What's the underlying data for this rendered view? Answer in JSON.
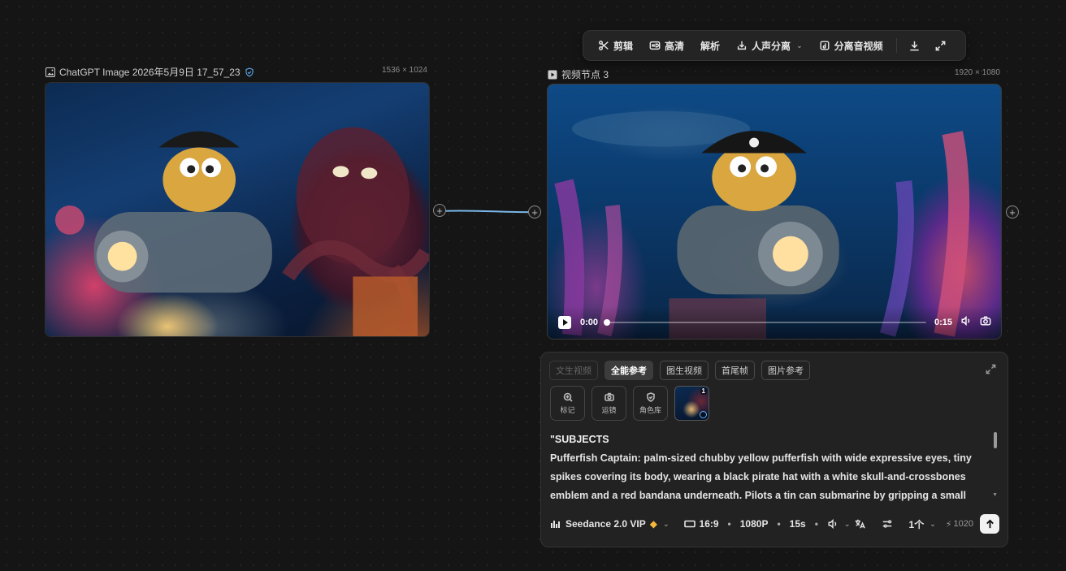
{
  "toolbar": {
    "cut_label": "剪辑",
    "hd_label": "高清",
    "parse_label": "解析",
    "vocal_label": "人声分离",
    "av_split_label": "分离音视频",
    "icons": [
      "scissors-icon",
      "hd-icon",
      "vocal-split-icon",
      "av-split-icon",
      "download-icon",
      "fullscreen-icon"
    ]
  },
  "image_node": {
    "title": "ChatGPT Image 2026年5月9日 17_57_23",
    "dimensions": "1536 × 1024"
  },
  "video_node": {
    "title": "视频节点 3",
    "dimensions": "1920 × 1080",
    "current_time": "0:00",
    "duration": "0:15",
    "progress": 0
  },
  "panel": {
    "tabs": [
      {
        "label": "文生视频",
        "state": "disabled"
      },
      {
        "label": "全能参考",
        "state": "active"
      },
      {
        "label": "图生视频",
        "state": "normal"
      },
      {
        "label": "首尾帧",
        "state": "normal"
      },
      {
        "label": "图片参考",
        "state": "normal"
      }
    ],
    "tools": [
      {
        "label": "标记",
        "icon": "marker-icon"
      },
      {
        "label": "运镜",
        "icon": "camera-icon"
      },
      {
        "label": "角色库",
        "icon": "shield-icon"
      }
    ],
    "reference_badge": "1",
    "prompt_title": "\"SUBJECTS",
    "prompt_text": "Pufferfish Captain: palm-sized chubby yellow pufferfish with wide expressive eyes, tiny spikes covering its body, wearing a black pirate hat with a white skull-and-crossbones emblem and a red bandana underneath. Pilots a tin can submarine by gripping a small brass",
    "model": "Seedance 2.0 VIP",
    "ratio": "16:9",
    "resolution": "1080P",
    "duration": "15s",
    "count": "1个",
    "credits": "1020"
  },
  "colors": {
    "background": "#151515",
    "panel": "#222222",
    "accent_verified": "#5fb3ff",
    "vip_gold": "#f5b73b"
  }
}
